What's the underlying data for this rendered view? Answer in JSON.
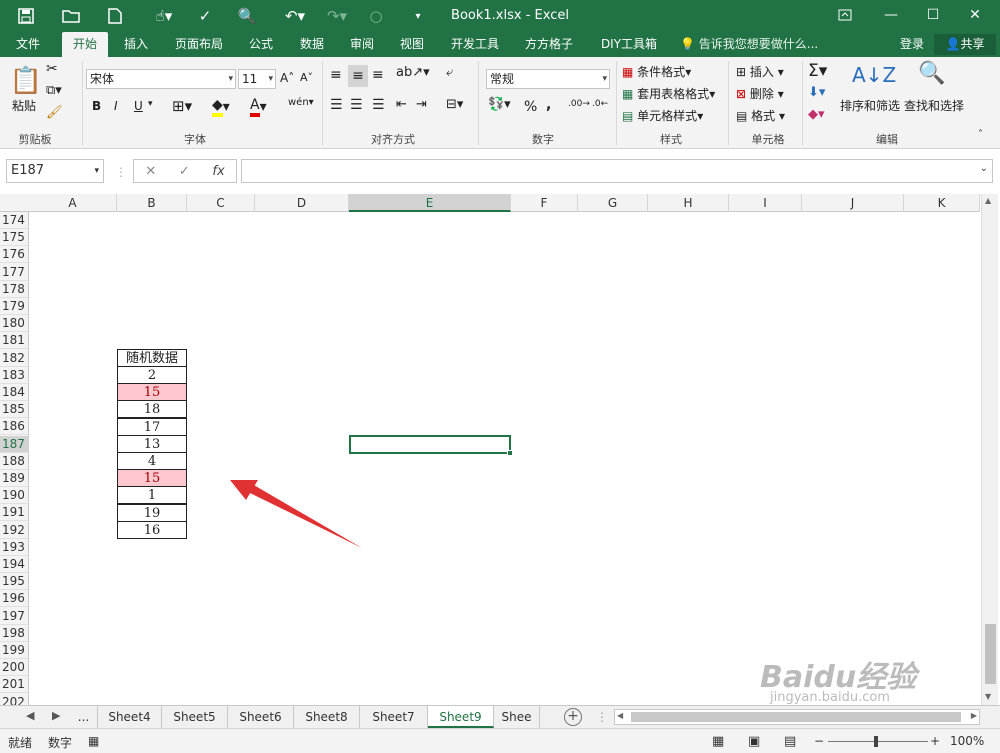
{
  "app": {
    "title": "Book1.xlsx - Excel",
    "login": "登录",
    "share": "共享",
    "tell_me": "告诉我您想要做什么..."
  },
  "tabs": [
    "文件",
    "开始",
    "插入",
    "页面布局",
    "公式",
    "数据",
    "审阅",
    "视图",
    "开发工具",
    "方方格子",
    "DIY工具箱"
  ],
  "active_tab": "开始",
  "ribbon": {
    "clipboard": {
      "paste": "粘贴",
      "label": "剪贴板"
    },
    "font": {
      "name": "宋体",
      "size": "11",
      "label": "字体",
      "bold": "B",
      "italic": "I",
      "underline": "U"
    },
    "alignment": {
      "label": "对齐方式"
    },
    "number": {
      "format": "常规",
      "label": "数字",
      "percent": "%",
      "comma": ","
    },
    "styles": {
      "conditional": "条件格式",
      "table": "套用表格格式",
      "cell_styles": "单元格样式",
      "label": "样式"
    },
    "cells": {
      "insert": "插入",
      "delete": "删除",
      "format": "格式",
      "label": "单元格"
    },
    "editing": {
      "sort_filter": "排序和筛选",
      "find_select": "查找和选择",
      "label": "编辑"
    }
  },
  "formula_bar": {
    "name_box": "E187",
    "fx": "fx",
    "value": ""
  },
  "columns": [
    "A",
    "B",
    "C",
    "D",
    "E",
    "F",
    "G",
    "H",
    "I",
    "J",
    "K"
  ],
  "selected_column": "E",
  "rows": [
    "174",
    "175",
    "176",
    "177",
    "178",
    "179",
    "180",
    "181",
    "182",
    "183",
    "184",
    "185",
    "186",
    "187",
    "188",
    "189",
    "190",
    "191",
    "192",
    "193",
    "194",
    "195",
    "196",
    "197",
    "198",
    "199",
    "200",
    "201",
    "202"
  ],
  "selected_row": "187",
  "table": {
    "header": "随机数据",
    "values": [
      "2",
      "15",
      "18",
      "17",
      "13",
      "4",
      "15",
      "1",
      "19",
      "16"
    ],
    "highlighted": [
      false,
      true,
      false,
      false,
      false,
      false,
      true,
      false,
      false,
      false
    ]
  },
  "highlight_color": "#ffc7ce",
  "sheets": [
    "...",
    "Sheet4",
    "Sheet5",
    "Sheet6",
    "Sheet8",
    "Sheet7",
    "Sheet9",
    "Shee"
  ],
  "active_sheet": "Sheet9",
  "status": {
    "ready": "就绪",
    "mode": "数字",
    "zoom": "100%"
  },
  "watermark": {
    "brand": "Baidu经验",
    "url": "jingyan.baidu.com"
  }
}
